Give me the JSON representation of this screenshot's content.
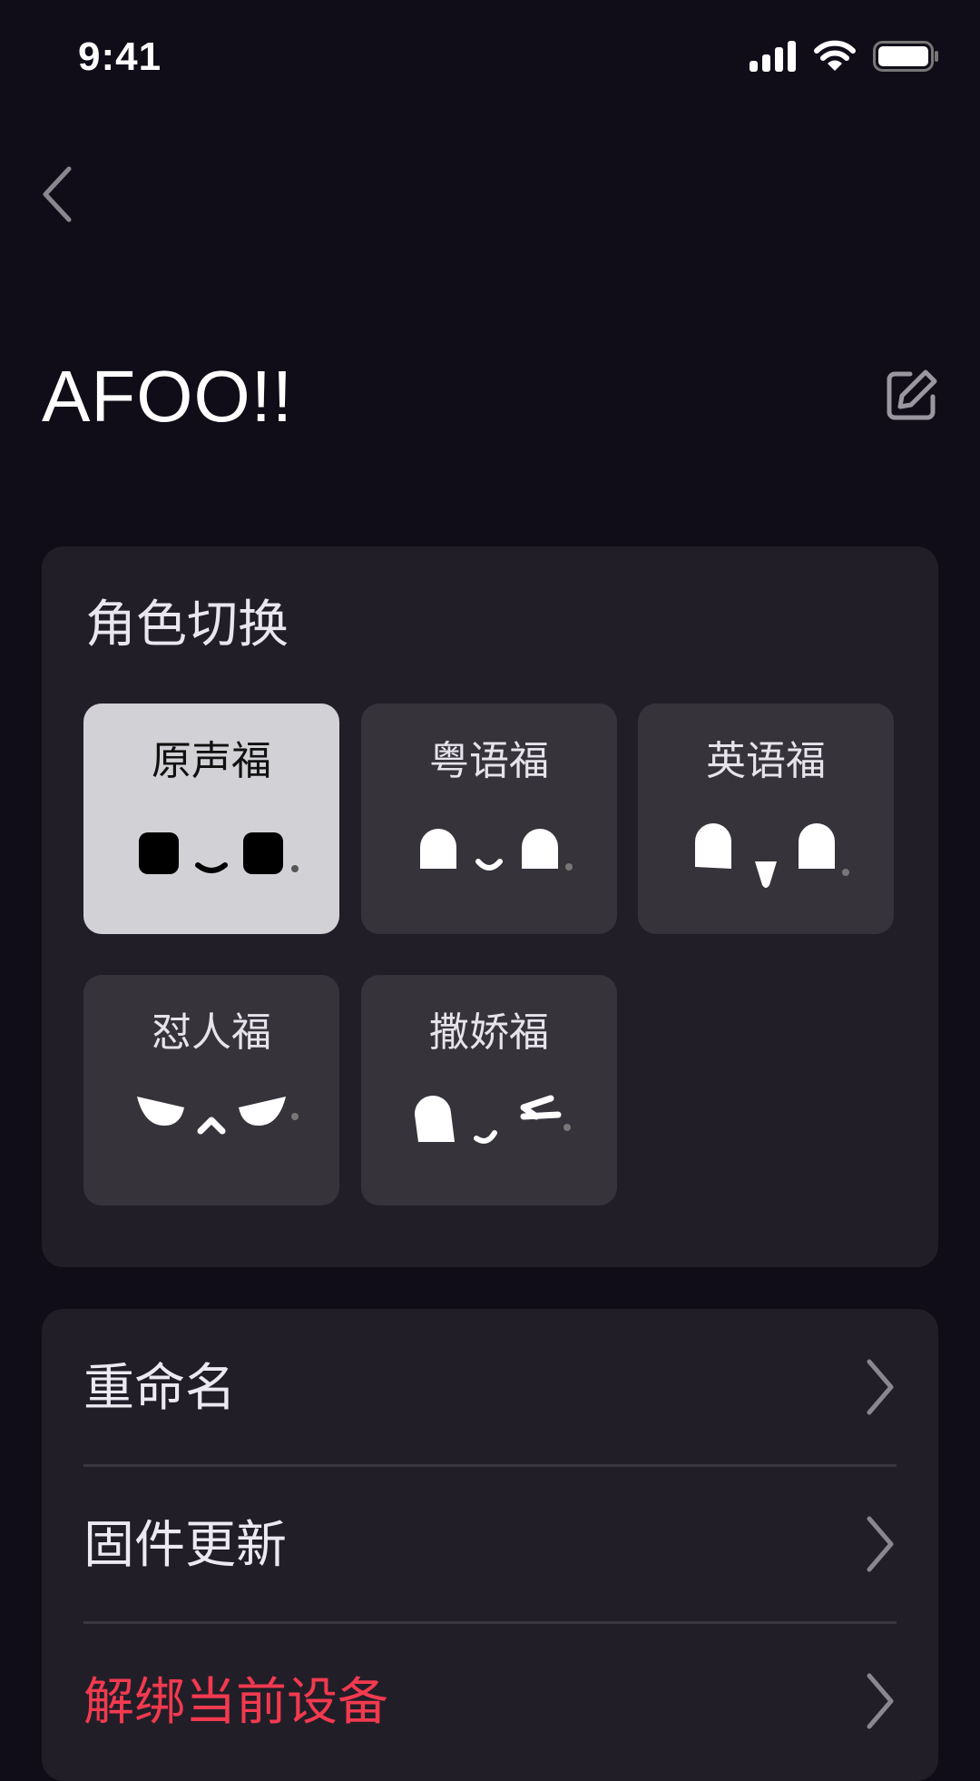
{
  "status_bar": {
    "time": "9:41"
  },
  "header": {
    "title": "AFOO!!"
  },
  "role_switch": {
    "title": "角色切换",
    "roles": [
      {
        "label": "原声福",
        "selected": true,
        "face": "calm"
      },
      {
        "label": "粤语福",
        "selected": false,
        "face": "smile"
      },
      {
        "label": "英语福",
        "selected": false,
        "face": "tooth"
      },
      {
        "label": "怼人福",
        "selected": false,
        "face": "annoyed"
      },
      {
        "label": "撒娇福",
        "selected": false,
        "face": "wink"
      }
    ]
  },
  "menu": {
    "items": [
      {
        "label": "重命名",
        "danger": false
      },
      {
        "label": "固件更新",
        "danger": false
      },
      {
        "label": "解绑当前设备",
        "danger": true
      }
    ]
  },
  "colors": {
    "background": "#110d18",
    "card": "#221e28",
    "tile": "#36333b",
    "tile_selected": "#d2d2d6",
    "danger": "#f23a4f"
  }
}
